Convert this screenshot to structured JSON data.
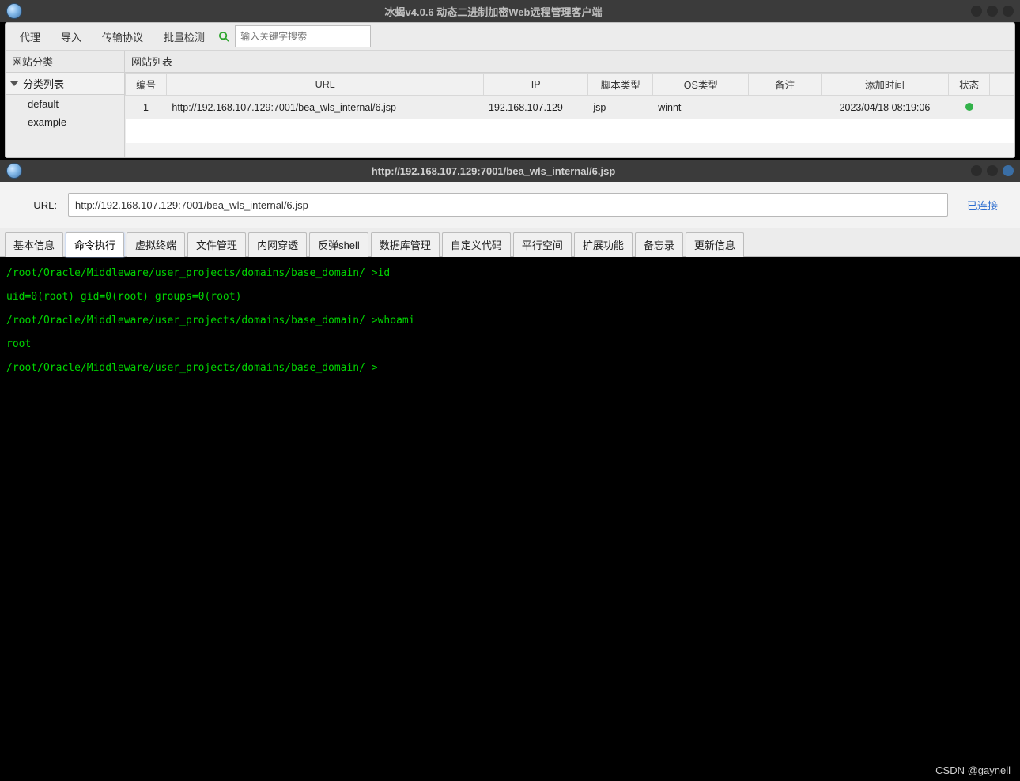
{
  "window1": {
    "title": "冰蝎v4.0.6 动态二进制加密Web远程管理客户端",
    "menu": {
      "proxy": "代理",
      "import": "导入",
      "transport": "传输协议",
      "batch": "批量检测"
    },
    "search": {
      "placeholder": "输入关键字搜索"
    },
    "sidebar": {
      "header": "网站分类",
      "tree_header": "分类列表",
      "items": [
        "default",
        "example"
      ]
    },
    "list": {
      "header": "网站列表",
      "columns": {
        "num": "编号",
        "url": "URL",
        "ip": "IP",
        "script": "脚本类型",
        "os": "OS类型",
        "note": "备注",
        "time": "添加时间",
        "status": "状态"
      },
      "rows": [
        {
          "num": "1",
          "url": "http://192.168.107.129:7001/bea_wls_internal/6.jsp",
          "ip": "192.168.107.129",
          "script": "jsp",
          "os": "winnt",
          "note": "",
          "time": "2023/04/18 08:19:06",
          "status": "ok"
        }
      ]
    }
  },
  "window2": {
    "title": "http://192.168.107.129:7001/bea_wls_internal/6.jsp",
    "url_label": "URL:",
    "url_value": "http://192.168.107.129:7001/bea_wls_internal/6.jsp",
    "status": "已连接",
    "tabs": [
      "基本信息",
      "命令执行",
      "虚拟终端",
      "文件管理",
      "内网穿透",
      "反弹shell",
      "数据库管理",
      "自定义代码",
      "平行空间",
      "扩展功能",
      "备忘录",
      "更新信息"
    ],
    "active_tab_index": 1,
    "terminal": {
      "lines": [
        "/root/Oracle/Middleware/user_projects/domains/base_domain/ >id",
        "uid=0(root) gid=0(root) groups=0(root)",
        "/root/Oracle/Middleware/user_projects/domains/base_domain/ >whoami",
        "root",
        "/root/Oracle/Middleware/user_projects/domains/base_domain/ >"
      ]
    }
  },
  "watermark": "CSDN @gaynell"
}
